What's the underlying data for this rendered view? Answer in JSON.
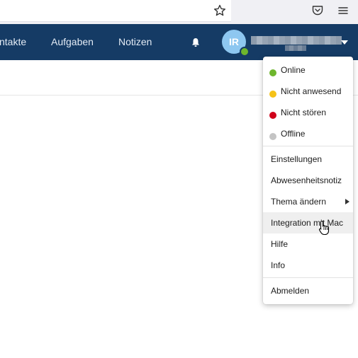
{
  "app_nav": {
    "tabs": [
      "ntakte",
      "Aufgaben",
      "Notizen"
    ],
    "avatar_initials": "IR"
  },
  "user_menu": {
    "status_items": [
      {
        "label": "Online",
        "color": "#6eb62d"
      },
      {
        "label": "Nicht anwesend",
        "color": "#f5c218"
      },
      {
        "label": "Nicht stören",
        "color": "#d0021b"
      },
      {
        "label": "Offline",
        "color": "#c4c4c4"
      }
    ],
    "items": [
      "Einstellungen",
      "Abwesenheitsnotiz",
      "Thema ändern",
      "Integration mit Mac",
      "Hilfe",
      "Info"
    ],
    "logout": "Abmelden"
  },
  "colors": {
    "nav_background": "#153b65",
    "avatar": "#8ec7f0",
    "presence": "#6eb62d"
  }
}
